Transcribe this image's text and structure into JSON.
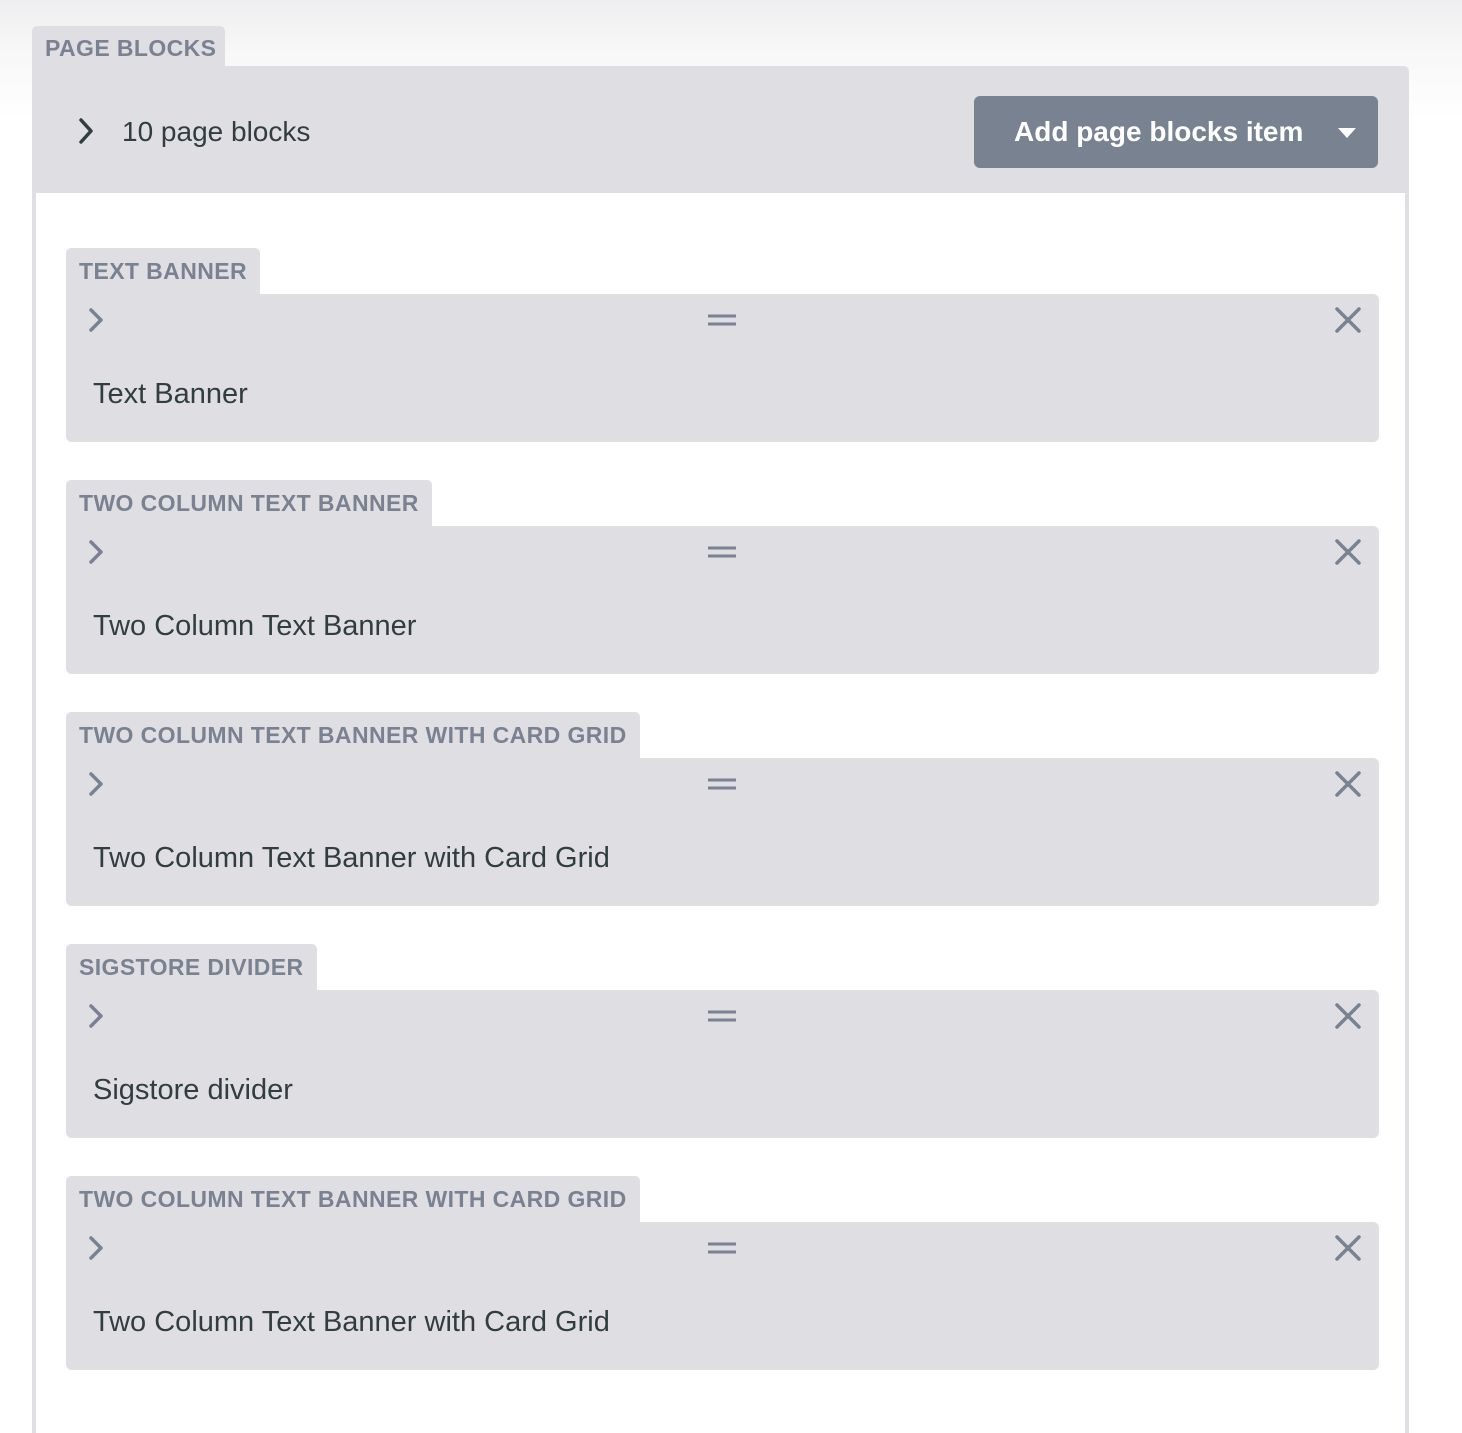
{
  "field": {
    "label": "PAGE BLOCKS",
    "count_text": "10 page blocks",
    "add_button_label": "Add page blocks item"
  },
  "items": [
    {
      "type_label": "TEXT BANNER",
      "summary": "Text Banner"
    },
    {
      "type_label": "TWO COLUMN TEXT BANNER",
      "summary": "Two Column Text Banner"
    },
    {
      "type_label": "TWO COLUMN TEXT BANNER WITH CARD GRID",
      "summary": "Two Column Text Banner with Card Grid"
    },
    {
      "type_label": "SIGSTORE DIVIDER",
      "summary": "Sigstore divider"
    },
    {
      "type_label": "TWO COLUMN TEXT BANNER WITH CARD GRID",
      "summary": "Two Column Text Banner with Card Grid"
    }
  ],
  "icons": {
    "collapse": "chevron-right-icon",
    "drag": "drag-handle-icon",
    "remove": "close-icon",
    "dropdown": "caret-down-icon"
  },
  "colors": {
    "panel_bg": "#dfdfe3",
    "label_text": "#7a8291",
    "button_bg": "#798291",
    "body_text": "#313d3e"
  }
}
